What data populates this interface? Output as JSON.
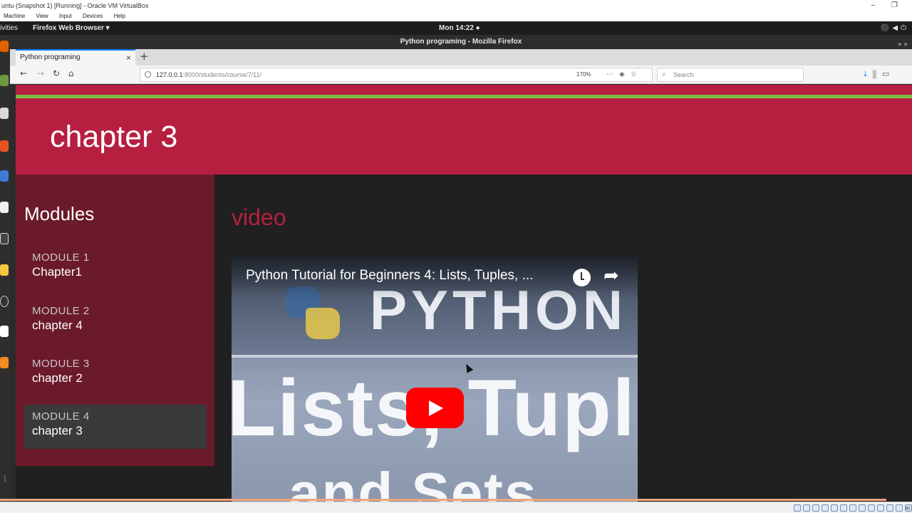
{
  "vbox": {
    "title": "untu (Snapshot 1) [Running] - Oracle VM VirtualBox",
    "menu": [
      "Machine",
      "View",
      "Input",
      "Devices",
      "Help"
    ],
    "status_text": "Ri"
  },
  "panel": {
    "activities": "ivities",
    "app_menu": "Firefox Web Browser ▾",
    "clock": "Mon 14:22 ●"
  },
  "firefox": {
    "window_title": "Python programing - Mozilla Firefox",
    "tab_title": "Python programing",
    "url_host": "127.0.0.1",
    "url_path": ":8000/students/course/7/11/",
    "zoom": "170%",
    "search_placeholder": "Search"
  },
  "page": {
    "hero_title": "chapter 3",
    "sidebar_title": "Modules",
    "modules": [
      {
        "label": "MODULE 1",
        "name": "Chapter1"
      },
      {
        "label": "MODULE 2",
        "name": "chapter 4"
      },
      {
        "label": "MODULE 3",
        "name": "chapter 2"
      },
      {
        "label": "MODULE 4",
        "name": "chapter 3"
      }
    ],
    "section_heading": "video",
    "video": {
      "title": "Python Tutorial for Beginners 4: Lists, Tuples, ...",
      "thumb_line1": "PYTHON",
      "thumb_line2": "Lists, Tuples,",
      "thumb_line3": "and Sets"
    }
  },
  "colors": {
    "brand": "#b71f40",
    "sidebar": "#6b1a2b",
    "accent_line": "#7bbf45",
    "content_bg": "#202020"
  }
}
